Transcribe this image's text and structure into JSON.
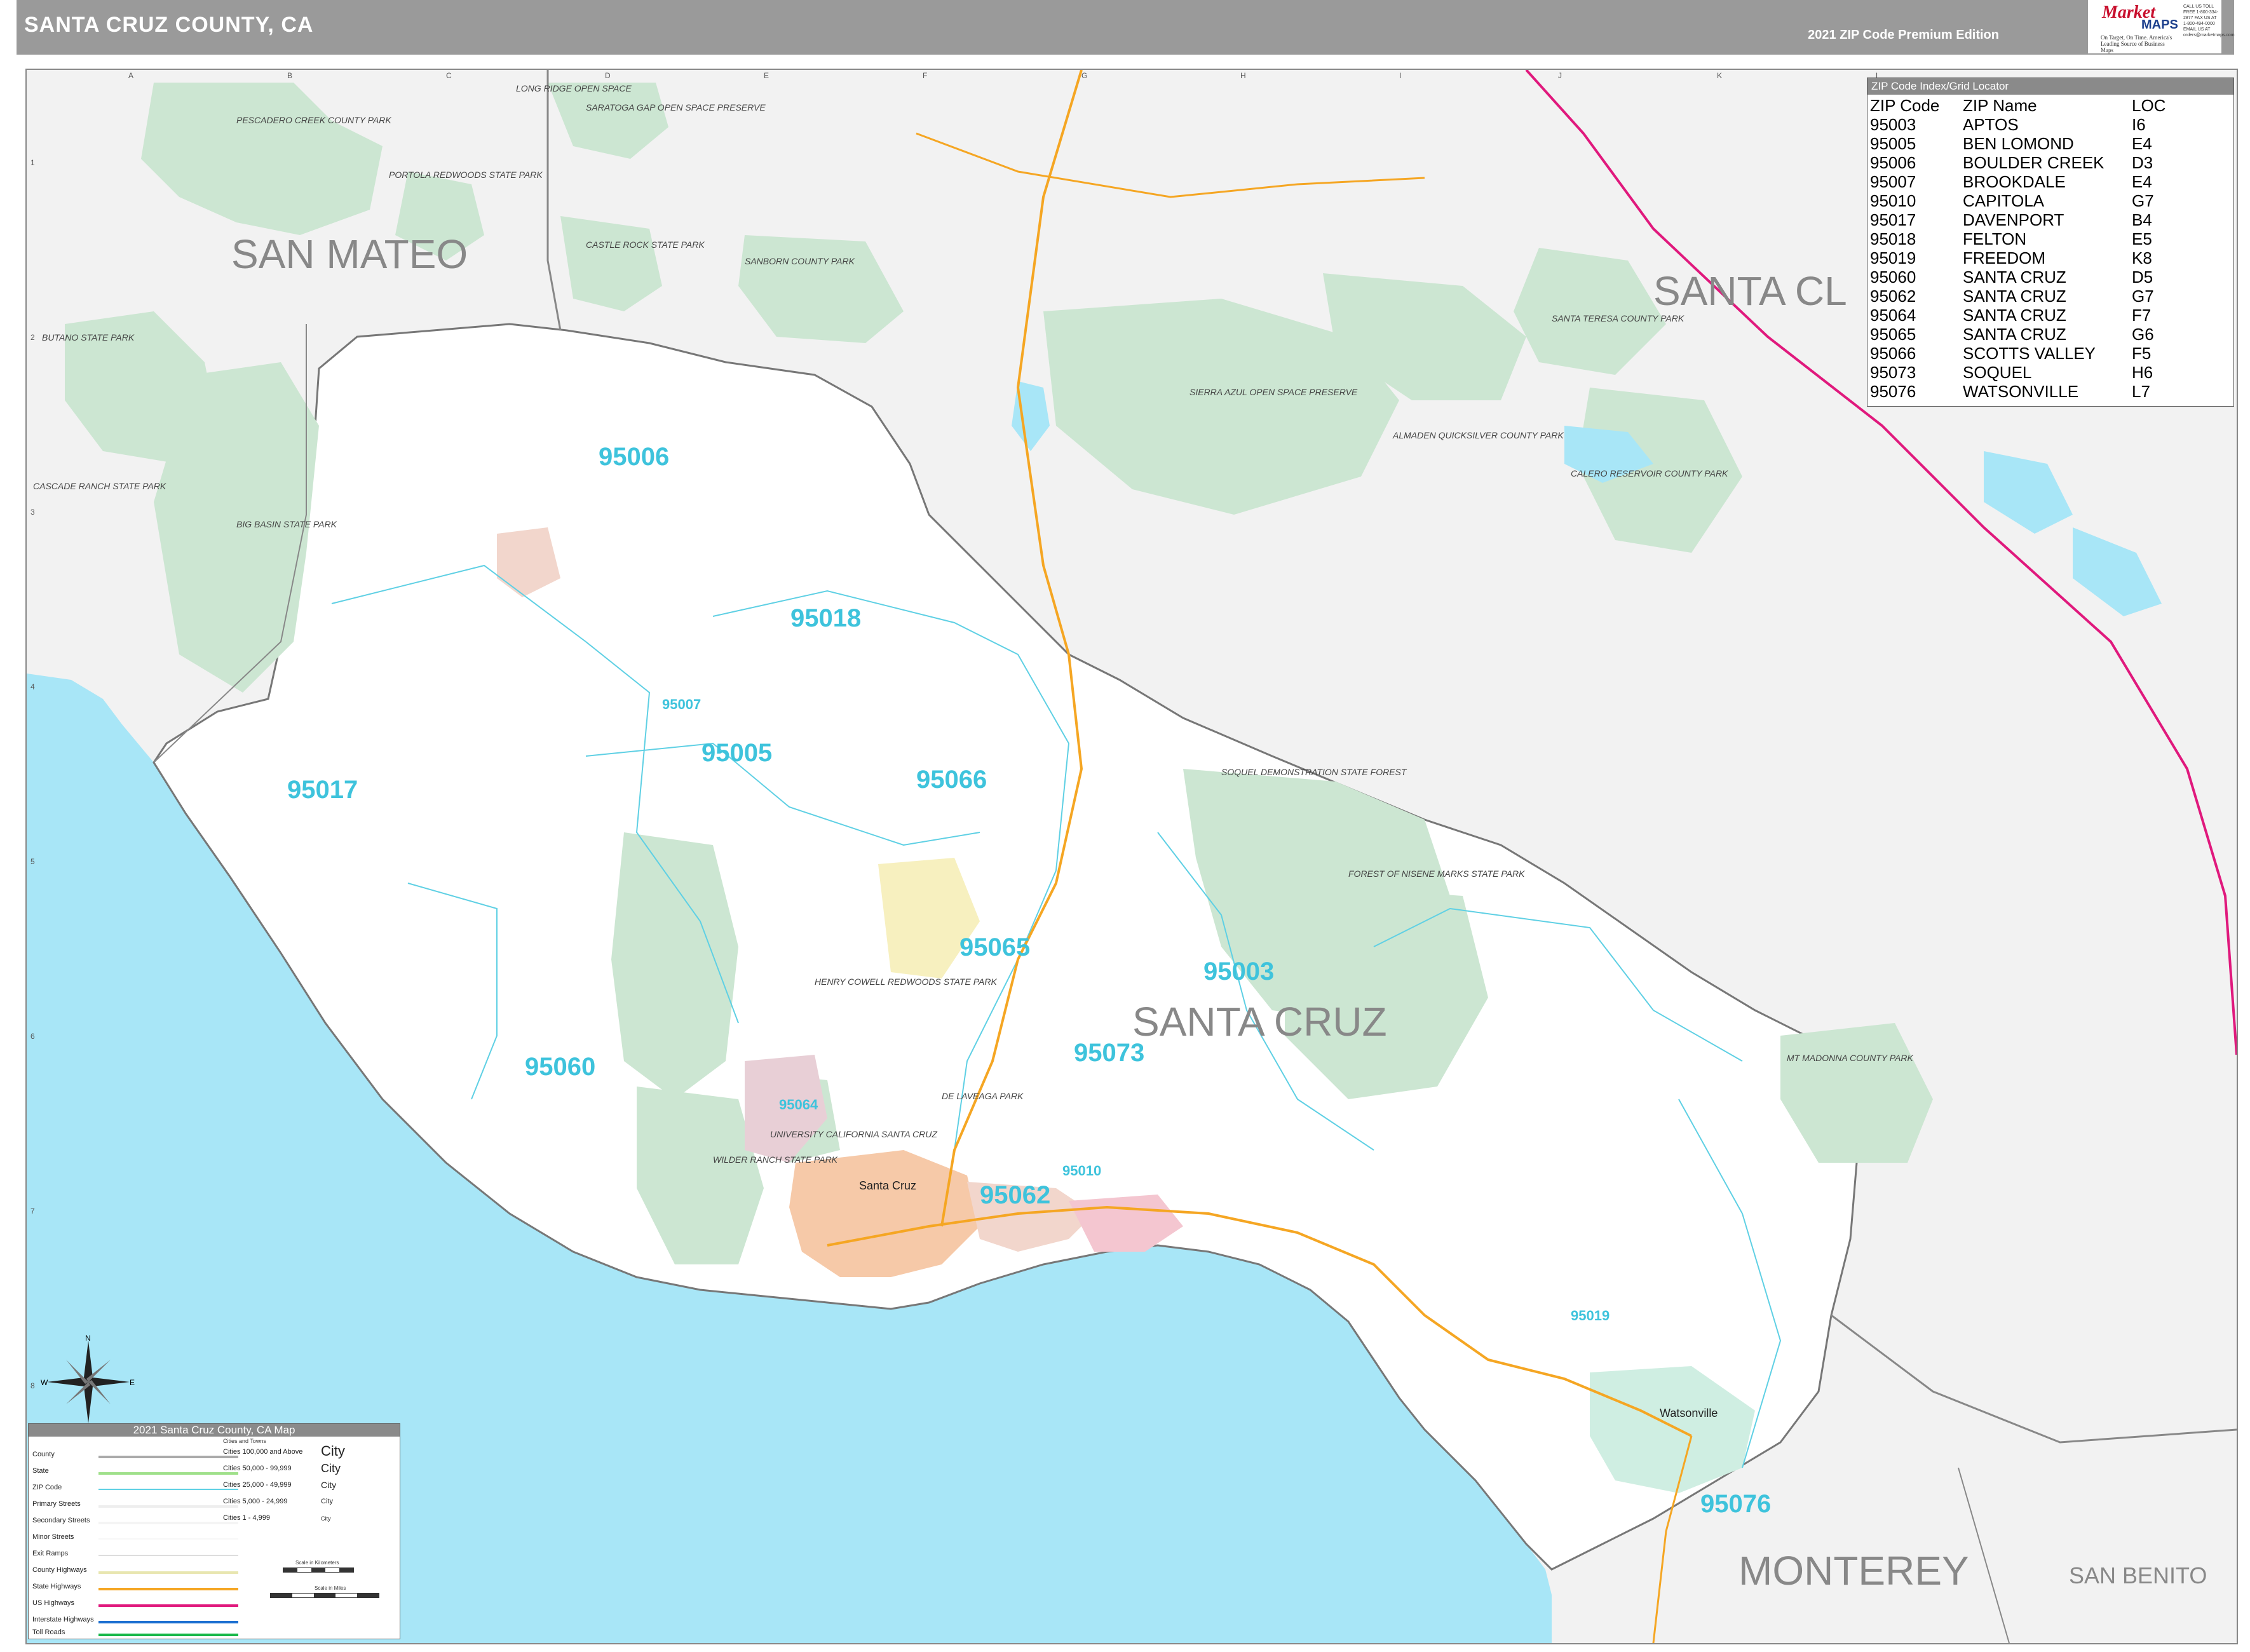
{
  "header": {
    "title": "SANTA CRUZ COUNTY, CA",
    "edition": "2021 ZIP Code Premium Edition",
    "logo_market": "Market",
    "logo_maps": "MAPS",
    "logo_tagline": "On Target, On Time. America's Leading Source of Business Maps",
    "logo_contact": "CALL US TOLL FREE 1-800-334-2877 FAX US AT 1-800-494-0000 EMAIL US AT orders@marketmaps.com"
  },
  "grid": {
    "columns": [
      "A",
      "B",
      "C",
      "D",
      "E",
      "F",
      "G",
      "H",
      "I",
      "J",
      "K",
      "L"
    ],
    "rows": [
      "1",
      "2",
      "3",
      "4",
      "5",
      "6",
      "7",
      "8"
    ]
  },
  "counties": {
    "san_mateo": "SAN MATEO",
    "santa_clara": "SANTA CL",
    "santa_cruz": "SANTA CRUZ",
    "monterey": "MONTEREY",
    "san_benito": "SAN BENITO"
  },
  "zip_labels": {
    "z95006": "95006",
    "z95018": "95018",
    "z95005": "95005",
    "z95066": "95066",
    "z95017": "95017",
    "z95065": "95065",
    "z95003": "95003",
    "z95073": "95073",
    "z95060": "95060",
    "z95062": "95062",
    "z95064": "95064",
    "z95010": "95010",
    "z95019": "95019",
    "z95076": "95076",
    "z95007": "95007"
  },
  "parks": {
    "pescadero": "PESCADERO CREEK COUNTY PARK",
    "portola": "PORTOLA REDWOODS STATE PARK",
    "long_ridge": "LONG RIDGE OPEN SPACE",
    "saratoga_gap": "SARATOGA GAP OPEN SPACE PRESERVE",
    "castle_rock": "CASTLE ROCK STATE PARK",
    "sanborn": "SANBORN COUNTY PARK",
    "butano": "BUTANO STATE PARK",
    "cascade": "CASCADE RANCH STATE PARK",
    "big_basin": "BIG BASIN STATE PARK",
    "sierra_azul": "SIERRA AZUL OPEN SPACE PRESERVE",
    "almaden": "ALMADEN QUICKSILVER COUNTY PARK",
    "santa_teresa": "SANTA TERESA COUNTY PARK",
    "calero": "CALERO RESERVOIR COUNTY PARK",
    "soquel_forest": "SOQUEL DEMONSTRATION STATE FOREST",
    "nisene_marks": "FOREST OF NISENE MARKS STATE PARK",
    "henry_cowell": "HENRY COWELL REDWOODS STATE PARK",
    "wilder_ranch": "WILDER RANCH STATE PARK",
    "delaveaga": "DE LAVEAGA PARK",
    "uc_santa_cruz": "UNIVERSITY CALIFORNIA SANTA CRUZ",
    "mt_madonna": "MT MADONNA COUNTY PARK"
  },
  "cities": {
    "santa_cruz": "Santa Cruz",
    "watsonville": "Watsonville"
  },
  "zip_index": {
    "title": "ZIP Code Index/Grid Locator",
    "headers": [
      "ZIP Code",
      "ZIP Name",
      "LOC"
    ],
    "rows": [
      [
        "95003",
        "APTOS",
        "I6"
      ],
      [
        "95005",
        "BEN LOMOND",
        "E4"
      ],
      [
        "95006",
        "BOULDER CREEK",
        "D3"
      ],
      [
        "95007",
        "BROOKDALE",
        "E4"
      ],
      [
        "95010",
        "CAPITOLA",
        "G7"
      ],
      [
        "95017",
        "DAVENPORT",
        "B4"
      ],
      [
        "95018",
        "FELTON",
        "E5"
      ],
      [
        "95019",
        "FREEDOM",
        "K8"
      ],
      [
        "95060",
        "SANTA CRUZ",
        "D5"
      ],
      [
        "95062",
        "SANTA CRUZ",
        "G7"
      ],
      [
        "95064",
        "SANTA CRUZ",
        "F7"
      ],
      [
        "95065",
        "SANTA CRUZ",
        "G6"
      ],
      [
        "95066",
        "SCOTTS VALLEY",
        "F5"
      ],
      [
        "95073",
        "SOQUEL",
        "H6"
      ],
      [
        "95076",
        "WATSONVILLE",
        "L7"
      ]
    ]
  },
  "legend": {
    "title": "2021 Santa Cruz County, CA Map",
    "items": [
      "County",
      "State",
      "ZIP Code",
      "Primary Streets",
      "Secondary Streets",
      "Minor Streets",
      "Exit Ramps",
      "County Highways",
      "State Highways",
      "US Highways",
      "Interstate Highways",
      "Toll Roads"
    ],
    "cities_header": "Cities and Towns",
    "city_sizes": [
      "Cities 100,000 and Above",
      "Cities 50,000 - 99,999",
      "Cities 25,000 - 49,999",
      "Cities 5,000 - 24,999",
      "Cities 1 - 4,999"
    ],
    "city_example": "City",
    "scale_km": "Scale in Kilometers",
    "scale_mi": "Scale in Miles"
  },
  "compass": {
    "n": "N",
    "s": "S",
    "e": "E",
    "w": "W"
  },
  "colors": {
    "ocean": "#a8e6f7",
    "land_outside": "#f2f2f2",
    "county_land": "#ffffff",
    "park": "#cce6d2",
    "zip_text": "#3ec3dc",
    "state_highway": "#f5a623",
    "us_highway": "#e0197d",
    "city_area": "#f6c9a8"
  }
}
